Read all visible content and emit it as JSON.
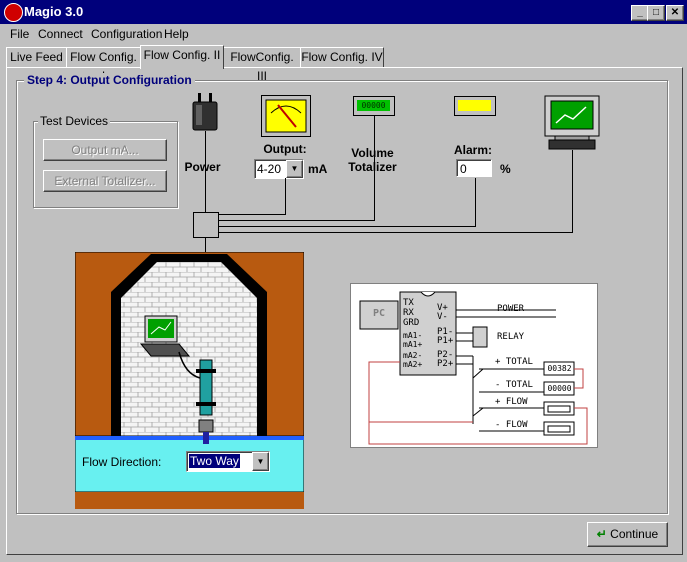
{
  "window": {
    "title": "Magio 3.0"
  },
  "menu": {
    "items": [
      "File",
      "Connect",
      "Configuration",
      "Help"
    ]
  },
  "tabs": [
    "Live Feed",
    "Flow Config. I",
    "Flow Config. II",
    "FlowConfig. III",
    "Flow Config. IV"
  ],
  "active_tab": "Flow Config. II",
  "step": {
    "title": "Step 4: Output Configuration"
  },
  "test_devices": {
    "title": "Test Devices",
    "output_button": "Output mA...",
    "totalizer_button": "External Totalizer..."
  },
  "devices": {
    "power_label": "Power",
    "output_label": "Output:",
    "output_value": "4-20",
    "output_unit": "mA",
    "totalizer_label_1": "Volume",
    "totalizer_label_2": "Totalizer",
    "totalizer_display": "00000",
    "alarm_label": "Alarm:",
    "alarm_value": "0",
    "alarm_unit": "%"
  },
  "flow": {
    "direction_label": "Flow Direction:",
    "direction_value": "Two Way"
  },
  "wiring": {
    "pc": "PC",
    "pins_left": [
      "TX",
      "RX",
      "GRD",
      "mA1-",
      "mA1+",
      "mA2-",
      "mA2+"
    ],
    "pins_right": [
      "V+",
      "V-",
      "P1-",
      "P1+",
      "P2-",
      "P2+"
    ],
    "power": "POWER",
    "relay": "RELAY",
    "plus_total": "+ TOTAL",
    "minus_total": "- TOTAL",
    "plus_flow": "+ FLOW",
    "minus_flow": "- FLOW",
    "counter_1": "00382",
    "counter_2": "00000"
  },
  "continue_button": "Continue",
  "colors": {
    "titlebar": "#00007b",
    "face": "#c0c0c0",
    "earth": "#b85a10",
    "water": "#68f0f0",
    "screen_green": "#00a000",
    "alarm_yellow": "#ffff00"
  }
}
